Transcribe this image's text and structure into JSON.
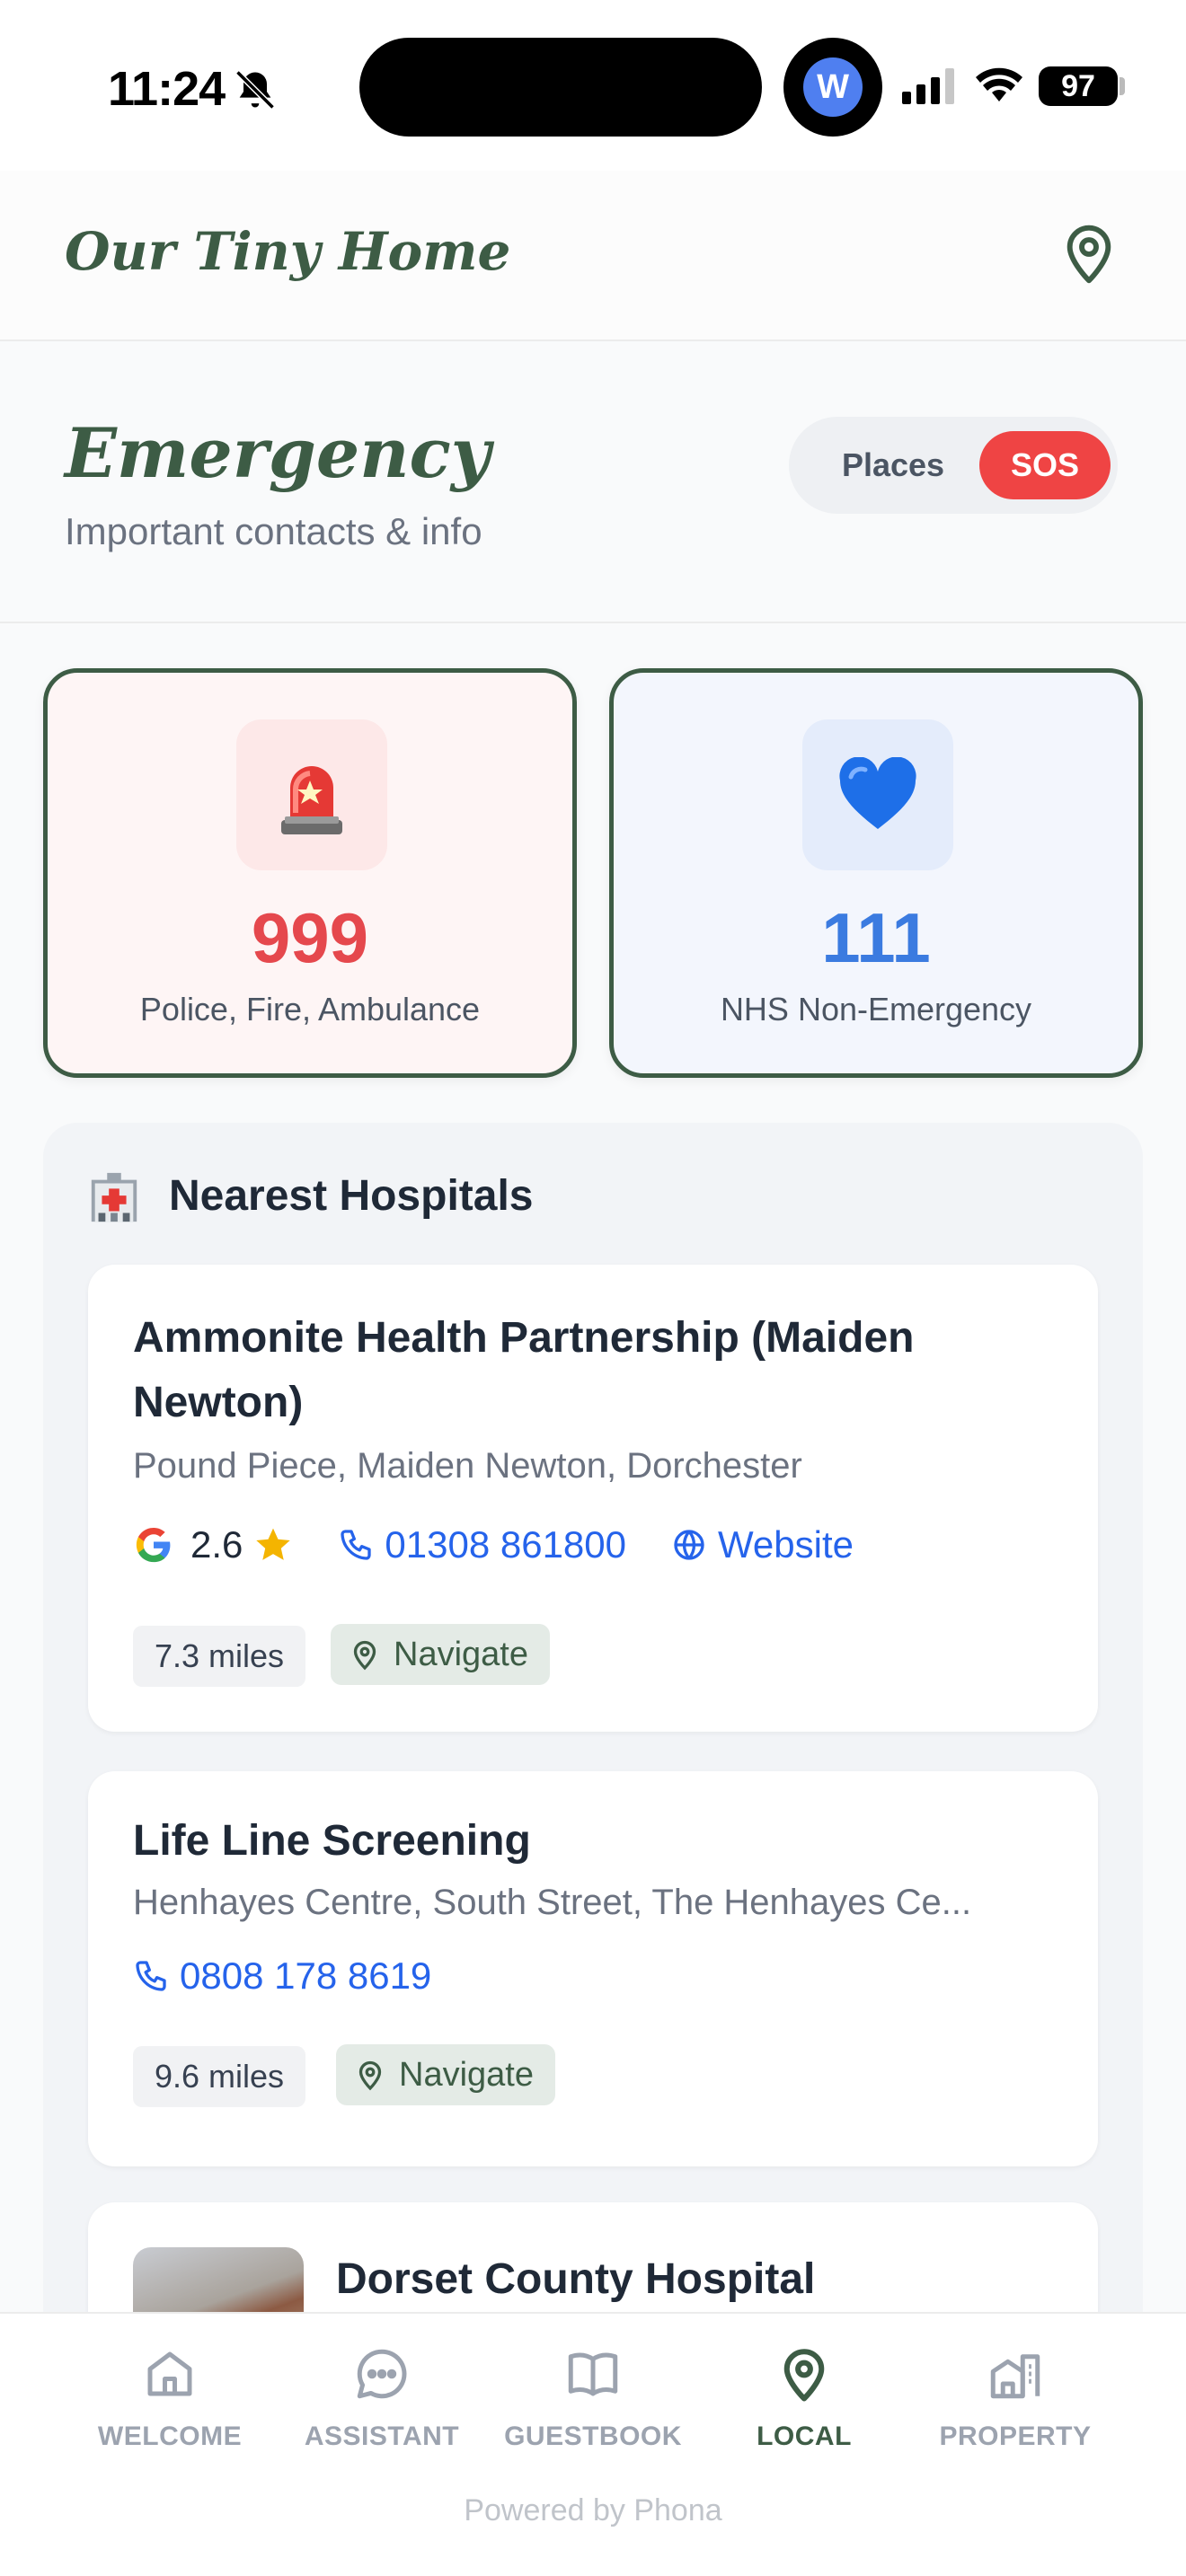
{
  "status_bar": {
    "time": "11:24",
    "account_initial": "W",
    "battery": "97"
  },
  "header": {
    "brand": "Our Tiny Home"
  },
  "section": {
    "title": "Emergency",
    "subtitle": "Important contacts & info",
    "toggle": {
      "places_label": "Places",
      "sos_label": "SOS",
      "selected": "SOS"
    }
  },
  "emergency_cards": [
    {
      "icon": "siren-icon",
      "emoji": "🚨",
      "number": "999",
      "label": "Police, Fire, Ambulance",
      "color": "#e5484d"
    },
    {
      "icon": "blue-heart-icon",
      "emoji": "💙",
      "number": "111",
      "label": "NHS Non-Emergency",
      "color": "#3b7be0"
    }
  ],
  "hospitals": {
    "title": "Nearest Hospitals",
    "icon": "hospital-icon",
    "items": [
      {
        "name": "Ammonite Health Partnership (Maiden Newton)",
        "address": "Pound Piece, Maiden Newton, Dorchester",
        "rating": "2.6",
        "phone": "01308 861800",
        "website_label": "Website",
        "distance": "7.3 miles",
        "navigate_label": "Navigate"
      },
      {
        "name": "Life Line Screening",
        "address": "Henhayes Centre, South Street, The Henhayes Ce...",
        "phone": "0808 178 8619",
        "distance": "9.6 miles",
        "navigate_label": "Navigate"
      },
      {
        "name": "Dorset County Hospital"
      }
    ]
  },
  "bottom_nav": {
    "items": [
      {
        "label": "WELCOME",
        "icon": "home-icon"
      },
      {
        "label": "ASSISTANT",
        "icon": "chat-icon"
      },
      {
        "label": "GUESTBOOK",
        "icon": "book-icon"
      },
      {
        "label": "LOCAL",
        "icon": "map-pin-icon",
        "active": true
      },
      {
        "label": "PROPERTY",
        "icon": "building-icon"
      }
    ],
    "powered_by": "Powered by Phona"
  },
  "colors": {
    "brand_green": "#3d5c45",
    "sos_red": "#ef4444",
    "link_blue": "#2563eb"
  }
}
